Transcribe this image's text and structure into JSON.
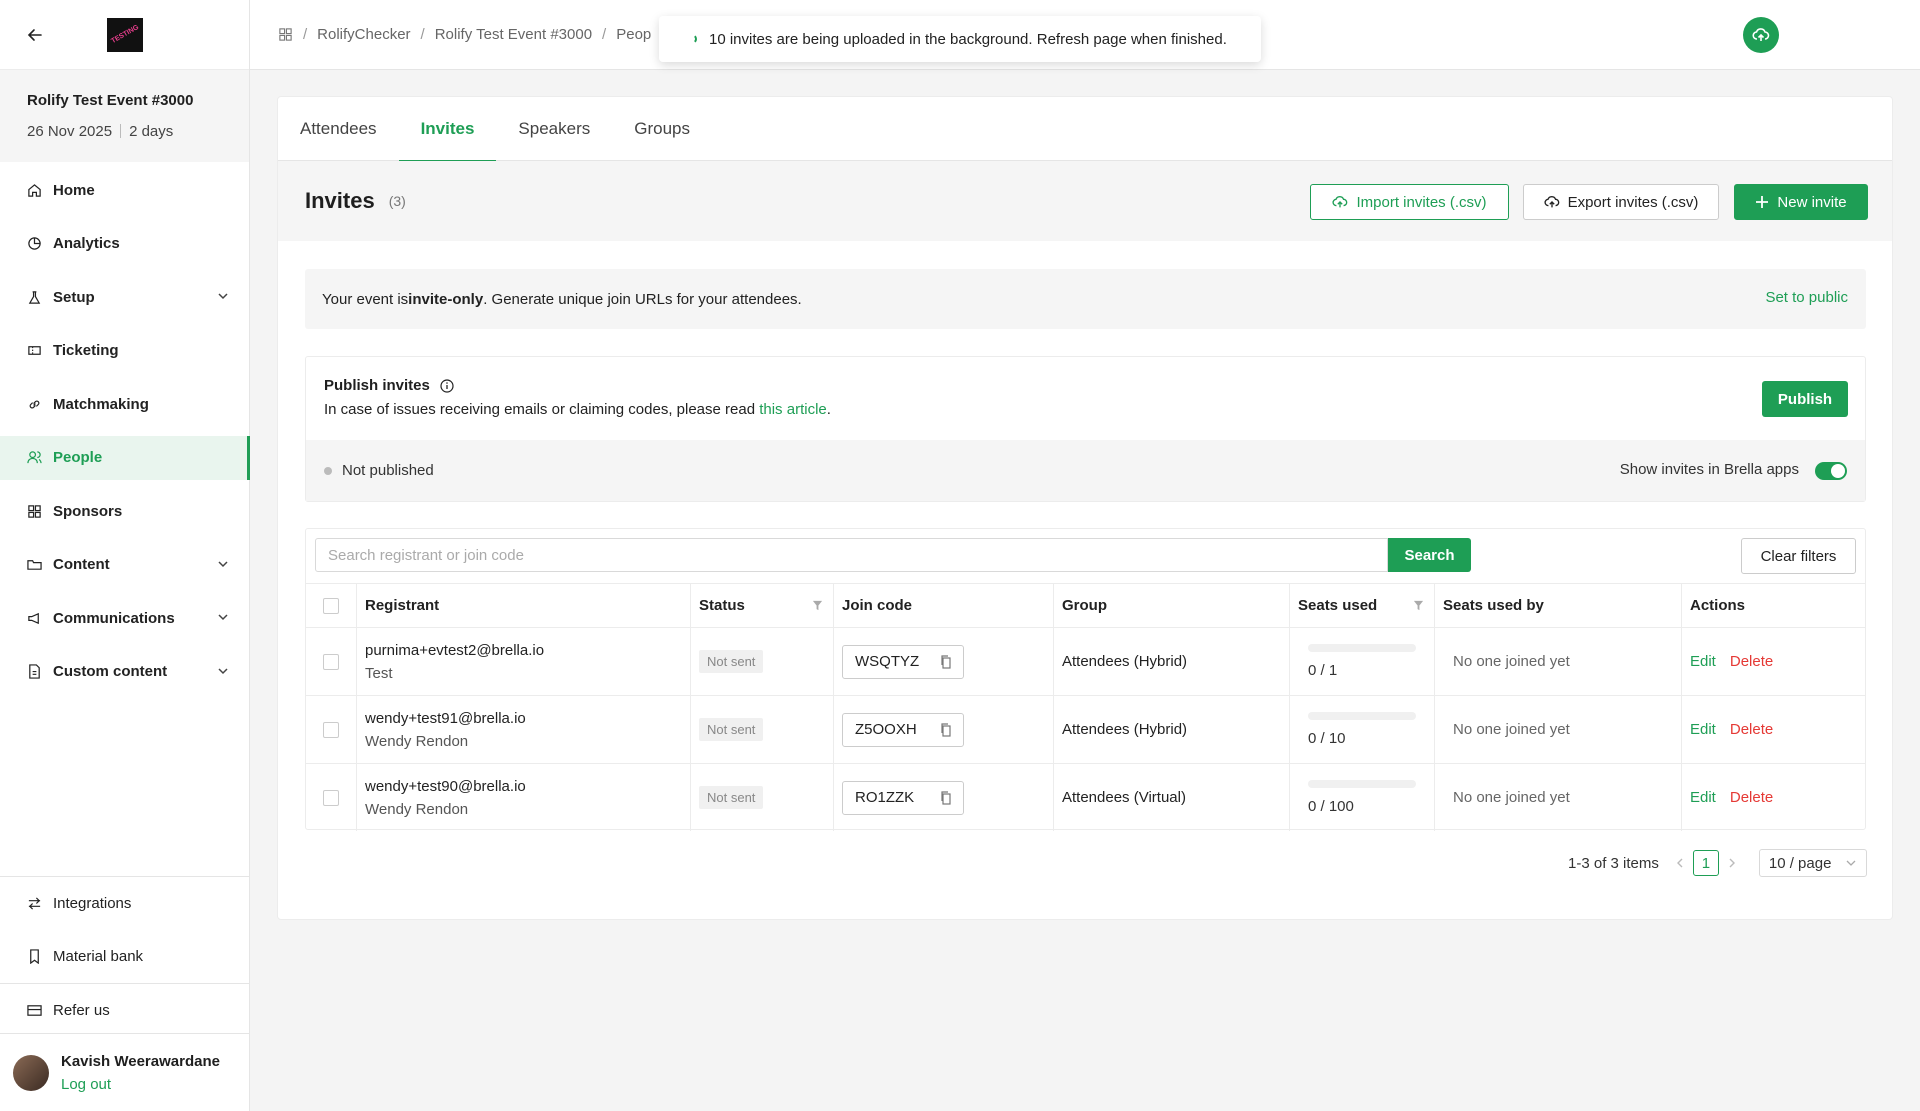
{
  "sidebar": {
    "logo_text": "TESTING",
    "event": {
      "name": "Rolify Test Event #3000",
      "date": "26 Nov 2025",
      "duration": "2 days"
    },
    "items": [
      {
        "label": "Home",
        "icon": "home-icon"
      },
      {
        "label": "Analytics",
        "icon": "pie-chart-icon"
      },
      {
        "label": "Setup",
        "icon": "flask-icon",
        "expandable": true
      },
      {
        "label": "Ticketing",
        "icon": "ticket-icon"
      },
      {
        "label": "Matchmaking",
        "icon": "link-icon"
      },
      {
        "label": "People",
        "icon": "users-icon",
        "active": true
      },
      {
        "label": "Sponsors",
        "icon": "grid-icon"
      },
      {
        "label": "Content",
        "icon": "folder-icon",
        "expandable": true
      },
      {
        "label": "Communications",
        "icon": "megaphone-icon",
        "expandable": true
      },
      {
        "label": "Custom content",
        "icon": "document-icon",
        "expandable": true
      }
    ],
    "bottom": {
      "integrations": "Integrations",
      "material_bank": "Material bank",
      "refer": "Refer us"
    },
    "user": {
      "name": "Kavish Weerawardane",
      "logout": "Log out"
    }
  },
  "topbar": {
    "breadcrumb": [
      "RolifyChecker",
      "Rolify Test Event #3000",
      "Peop"
    ],
    "toast": "10 invites are being uploaded in the background. Refresh page when finished."
  },
  "tabs": [
    {
      "label": "Attendees",
      "active": false
    },
    {
      "label": "Invites",
      "active": true
    },
    {
      "label": "Speakers",
      "active": false
    },
    {
      "label": "Groups",
      "active": false
    }
  ],
  "header": {
    "title": "Invites",
    "count": "(3)",
    "import_label": "Import invites (.csv)",
    "export_label": "Export invites (.csv)",
    "new_label": "New invite"
  },
  "notice": {
    "prefix": "Your event is ",
    "bold": "invite-only",
    "suffix": ". Generate unique join URLs for your attendees.",
    "set_public": "Set to public"
  },
  "publish": {
    "title": "Publish invites",
    "desc_prefix": "In case of issues receiving emails or claiming codes, please read ",
    "desc_link": "this article",
    "desc_suffix": ".",
    "button": "Publish",
    "status": "Not published",
    "show_label": "Show invites in Brella apps",
    "show_enabled": true
  },
  "search": {
    "placeholder": "Search registrant or join code",
    "button": "Search",
    "clear": "Clear filters"
  },
  "table": {
    "headers": {
      "registrant": "Registrant",
      "status": "Status",
      "join_code": "Join code",
      "group": "Group",
      "seats_used": "Seats used",
      "seats_used_by": "Seats used by",
      "actions": "Actions"
    },
    "rows": [
      {
        "email": "purnima+evtest2@brella.io",
        "name": "Test",
        "status": "Not sent",
        "code": "WSQTYZ",
        "group": "Attendees (Hybrid)",
        "seats": "0 / 1",
        "seats_fraction": 0,
        "used_by": "No one joined yet",
        "edit": "Edit",
        "delete": "Delete"
      },
      {
        "email": "wendy+test91@brella.io",
        "name": "Wendy Rendon",
        "status": "Not sent",
        "code": "Z5OOXH",
        "group": "Attendees (Hybrid)",
        "seats": "0 / 10",
        "seats_fraction": 0,
        "used_by": "No one joined yet",
        "edit": "Edit",
        "delete": "Delete"
      },
      {
        "email": "wendy+test90@brella.io",
        "name": "Wendy Rendon",
        "status": "Not sent",
        "code": "RO1ZZK",
        "group": "Attendees (Virtual)",
        "seats": "0 / 100",
        "seats_fraction": 0,
        "used_by": "No one joined yet",
        "edit": "Edit",
        "delete": "Delete"
      }
    ]
  },
  "pagination": {
    "summary": "1-3 of 3 items",
    "current": "1",
    "page_size": "10 / page"
  },
  "colors": {
    "accent": "#1e9e55",
    "danger": "#e53935"
  }
}
